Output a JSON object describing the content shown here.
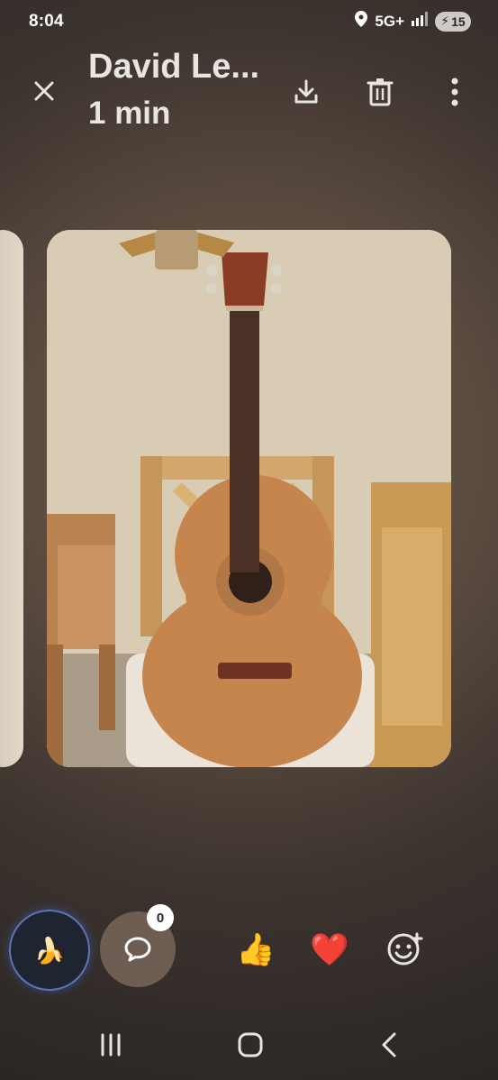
{
  "status_bar": {
    "time": "8:04",
    "network": "5G+",
    "battery_level": "15"
  },
  "header": {
    "title": "David Le...",
    "subtitle": "1 min",
    "icons": {
      "close": "close-icon",
      "download": "download-icon",
      "delete": "trash-icon",
      "more": "more-vertical-icon"
    }
  },
  "media": {
    "primary_description": "photo",
    "theme_color": "#cc8b4f"
  },
  "footer": {
    "comment_count": "0",
    "reactions": [
      {
        "name": "thumbs-up",
        "glyph": "👍"
      },
      {
        "name": "heart",
        "glyph": "❤️"
      },
      {
        "name": "add-reaction",
        "glyph": "😀"
      }
    ],
    "avatar_glyph": "🍌"
  },
  "navigation": {
    "recents": "recents-icon",
    "home": "home-icon",
    "back": "back-icon"
  }
}
